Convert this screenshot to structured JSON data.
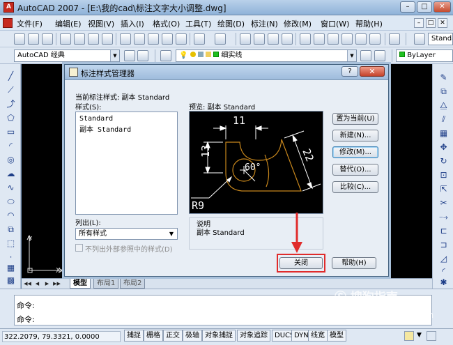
{
  "window": {
    "title": "AutoCAD 2007 - [E:\\我的cad\\标注文字大小调整.dwg]",
    "app_icon": "A",
    "controls": [
      "–",
      "□",
      "✕"
    ]
  },
  "menu": {
    "items": [
      "文件(F)",
      "编辑(E)",
      "视图(V)",
      "插入(I)",
      "格式(O)",
      "工具(T)",
      "绘图(D)",
      "标注(N)",
      "修改(M)",
      "窗口(W)",
      "帮助(H)"
    ],
    "mdi_controls": [
      "–",
      "□",
      "✕"
    ]
  },
  "toolbar1": {
    "text_style_combo": "Standard"
  },
  "toolbar2": {
    "workspace_combo": "AutoCAD 经典",
    "layer_combo": "细实线",
    "color_combo": "ByLayer"
  },
  "drawing": {
    "ucs_x": "X",
    "ucs_y": "Y",
    "tabs": [
      "模型",
      "布局1",
      "布局2"
    ]
  },
  "command": {
    "lines": [
      "命令:",
      "命令:"
    ]
  },
  "status": {
    "coords": "322.2079, 79.3321, 0.0000",
    "buttons": [
      "捕捉",
      "栅格",
      "正交",
      "极轴",
      "对象捕捉",
      "对象追踪",
      "DUCS",
      "DYN",
      "线宽",
      "模型"
    ]
  },
  "dialog": {
    "title": "标注样式管理器",
    "help_btn": "?",
    "close_btn": "✕",
    "current_style_label": "当前标注样式: 副本 Standard",
    "styles_label": "样式(S):",
    "styles": [
      "Standard",
      "副本 Standard"
    ],
    "preview_label": "预览: 副本 Standard",
    "list_label": "列出(L):",
    "list_value": "所有样式",
    "xref_checkbox_label": "不列出外部参照中的样式(D)",
    "description_label": "说明",
    "description_value": "副本 Standard",
    "buttons": {
      "set_current": "置为当前(U)",
      "new": "新建(N)...",
      "modify": "修改(M)...",
      "override": "替代(O)...",
      "compare": "比较(C)...",
      "close": "关闭",
      "help": "帮助(H)"
    },
    "preview_dims": {
      "top": "11",
      "left": "13",
      "diag": "22",
      "angle": "60°",
      "radius": "R9"
    }
  },
  "watermark": {
    "main": "搜狗指南",
    "sub": "zhinan.sogou.com"
  },
  "colors": {
    "highlight": "#e02b2b",
    "dim_lines": "#ffffff",
    "geometry": "#c8871c"
  }
}
